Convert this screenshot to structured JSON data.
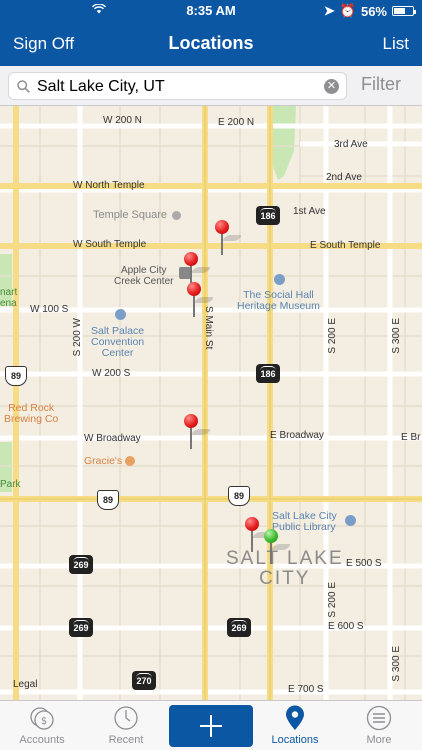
{
  "status_bar": {
    "time": "8:35 AM",
    "battery": "56%"
  },
  "nav": {
    "left": "Sign Off",
    "title": "Locations",
    "right": "List"
  },
  "search": {
    "value": "Salt Lake City, UT",
    "filter_label": "Filter"
  },
  "map": {
    "streets": {
      "w200n": "W 200 N",
      "e200n": "E 200 N",
      "third_ave": "3rd Ave",
      "second_ave": "2nd Ave",
      "w_north_temple": "W North Temple",
      "first_ave": "1st Ave",
      "w_south_temple": "W South Temple",
      "e_south_temple": "E South Temple",
      "w100s": "W 100 S",
      "w200s": "W 200 S",
      "w_broadway": "W Broadway",
      "e_broadway": "E Broadway",
      "e_br": "E Br",
      "e500s": "E 500 S",
      "e600s": "E 600 S",
      "e700s": "E 700 S",
      "s200w": "S 200 W",
      "s_main": "S Main St",
      "s200e_1": "S 200 E",
      "s200e_2": "S 200 E",
      "s300e_1": "S 300 E",
      "s300e_2": "S 300 E",
      "legal": "Legal"
    },
    "pois": {
      "temple_square": "Temple Square",
      "apple_city": "Apple City\nCreek Center",
      "social_hall": "The Social Hall\nHeritage Museum",
      "salt_palace": "Salt Palace\nConvention\nCenter",
      "red_rock": "Red Rock\nBrewing Co",
      "gracies": "Gracie's",
      "library": "Salt Lake City\nPublic Library",
      "arena_frag": "nart\nena",
      "park_frag": "Park",
      "city": "SALT LAKE\nCITY"
    },
    "shields": {
      "h186a": "186",
      "h186b": "186",
      "i89a": "89",
      "i89b": "89",
      "i89c": "89",
      "h269a": "269",
      "h269b": "269",
      "h269c": "269",
      "h270": "270"
    },
    "colors": {
      "pin_red": "#e41e1e",
      "pin_green": "#3dbb2e",
      "park": "#c9e6b5"
    }
  },
  "tabs": {
    "accounts": "Accounts",
    "recent": "Recent",
    "locations": "Locations",
    "more": "More"
  },
  "colors": {
    "brand": "#0b57a4"
  }
}
